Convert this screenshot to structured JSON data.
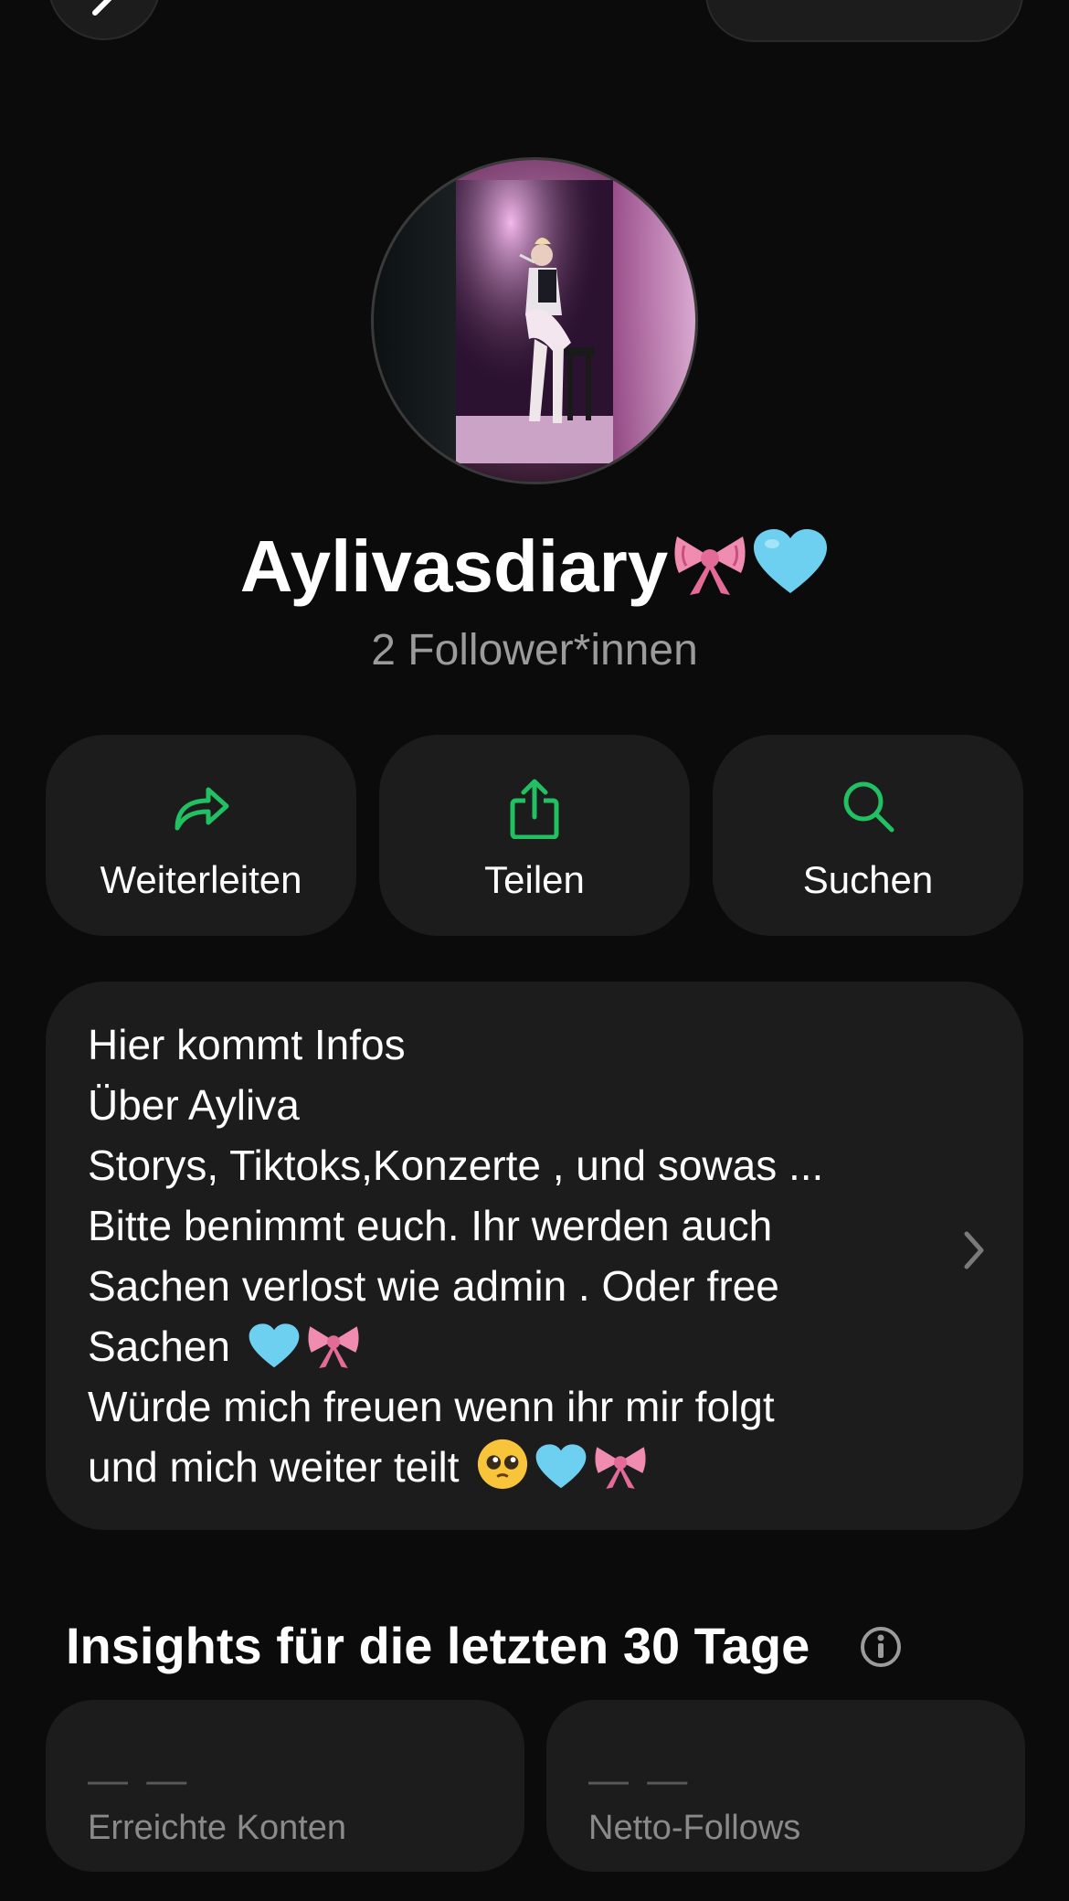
{
  "profile": {
    "name": "Aylivasdiary",
    "name_emojis": [
      "ribbon",
      "light-blue-heart"
    ],
    "followers": "2 Follower*innen"
  },
  "actions": [
    {
      "label": "Weiterleiten",
      "icon": "forward-arrow-icon"
    },
    {
      "label": "Teilen",
      "icon": "share-icon"
    },
    {
      "label": "Suchen",
      "icon": "search-icon"
    }
  ],
  "bio": {
    "lines": [
      "Hier kommt Infos",
      "Über Ayliva",
      "Storys, Tiktoks,Konzerte , und sowas ...",
      "Bitte benimmt euch. Ihr werden auch",
      "Sachen verlost wie admin . Oder free",
      "Sachen",
      "Würde mich freuen wenn ihr mir folgt",
      "und mich weiter teilt"
    ]
  },
  "insights": {
    "title": "Insights für die letzten 30 Tage",
    "stats": [
      {
        "value": "— —",
        "label": "Erreichte Konten"
      },
      {
        "value": "— —",
        "label": "Netto-Follows"
      }
    ]
  },
  "colors": {
    "background": "#0b0b0b",
    "card": "#1c1c1c",
    "accent_green": "#21c063",
    "secondary_text": "#9b9b9b"
  }
}
